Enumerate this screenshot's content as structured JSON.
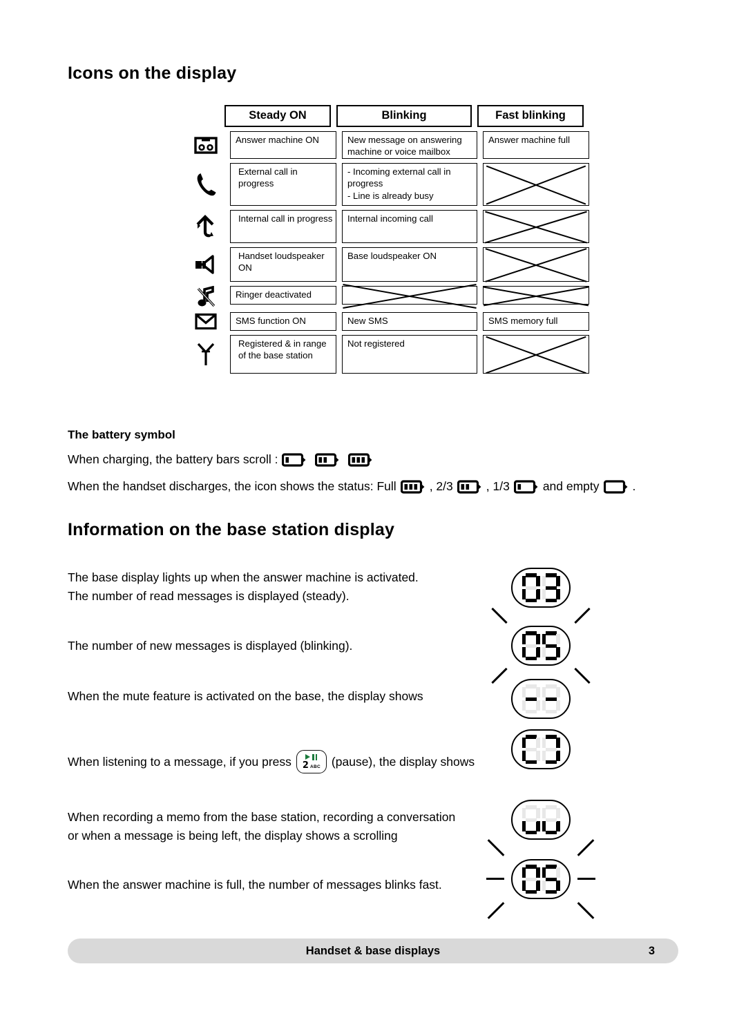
{
  "page": {
    "heading_icons": "Icons on the display",
    "heading_base": "Information on the base station display",
    "subheading_battery": "The battery symbol"
  },
  "icons_table": {
    "columns": [
      "Steady ON",
      "Blinking",
      "Fast blinking"
    ],
    "rows": [
      {
        "icon": "answering-machine-icon",
        "steady": "Answer machine ON",
        "blinking": "New message on answering machine or voice mailbox",
        "fast": "Answer machine full",
        "fast_crossed": false
      },
      {
        "icon": "phone-handset-icon",
        "steady": "External call in progress",
        "blinking": "- Incoming external call in progress\n- Line is already busy",
        "fast": "",
        "fast_crossed": true
      },
      {
        "icon": "internal-call-icon",
        "steady": "Internal call in progress",
        "blinking": "Internal incoming call",
        "fast": "",
        "fast_crossed": true
      },
      {
        "icon": "loudspeaker-icon",
        "steady": "Handset loudspeaker ON",
        "blinking": "Base loudspeaker ON",
        "fast": "",
        "fast_crossed": true
      },
      {
        "icon": "ringer-off-icon",
        "steady": "Ringer deactivated",
        "blinking": "",
        "blinking_crossed": true,
        "fast": "",
        "fast_crossed": true
      },
      {
        "icon": "envelope-sms-icon",
        "steady": "SMS function ON",
        "blinking": "New SMS",
        "fast": "SMS memory full",
        "fast_crossed": false
      },
      {
        "icon": "antenna-icon",
        "steady": "Registered & in range of the base station",
        "blinking": "Not registered",
        "fast": "",
        "fast_crossed": true
      }
    ]
  },
  "battery": {
    "line1_text": "When charging, the battery bars scroll :",
    "charging_levels": [
      1,
      2,
      3
    ],
    "line2_part1": "When the handset discharges, the icon shows the status: Full",
    "line2_part2": ", 2/3",
    "line2_part3": ", 1/3",
    "line2_part4": "and empty",
    "line2_part5": ".",
    "discharge_levels": [
      3,
      2,
      1,
      0
    ]
  },
  "base_station": {
    "paragraphs": [
      "The base display lights up when the answer machine is activated.\nThe number of read messages is displayed (steady).",
      "The number of new messages is displayed (blinking).",
      "When the mute feature is activated on the base, the display shows",
      "When recording a memo from the base station, recording a conversation\nor when a message is being left, the display shows a scrolling",
      "When the answer machine is full, the number of messages blinks fast."
    ],
    "press_line_part1": "When listening to a message, if you press",
    "press_line_part2": "(pause), the display shows",
    "key": {
      "digit": "2",
      "letters": "ABC",
      "icon_play": "play-icon",
      "icon_pause": "pause-icon",
      "icon_color": "#1a7a3c"
    },
    "displays": [
      {
        "name": "read-messages-display",
        "value": "03",
        "blink": "none"
      },
      {
        "name": "new-messages-display",
        "value": "05",
        "blink": "slow"
      },
      {
        "name": "mute-display",
        "value": "--",
        "blink": "none"
      },
      {
        "name": "pause-display",
        "value": "][",
        "blink": "none"
      },
      {
        "name": "scrolling-display",
        "value": "LL",
        "blink": "none"
      },
      {
        "name": "answer-machine-full-display",
        "value": "05",
        "blink": "fast"
      }
    ]
  },
  "footer": {
    "title": "Handset & base displays",
    "page_number": "3",
    "background": "#d9d9d9"
  }
}
